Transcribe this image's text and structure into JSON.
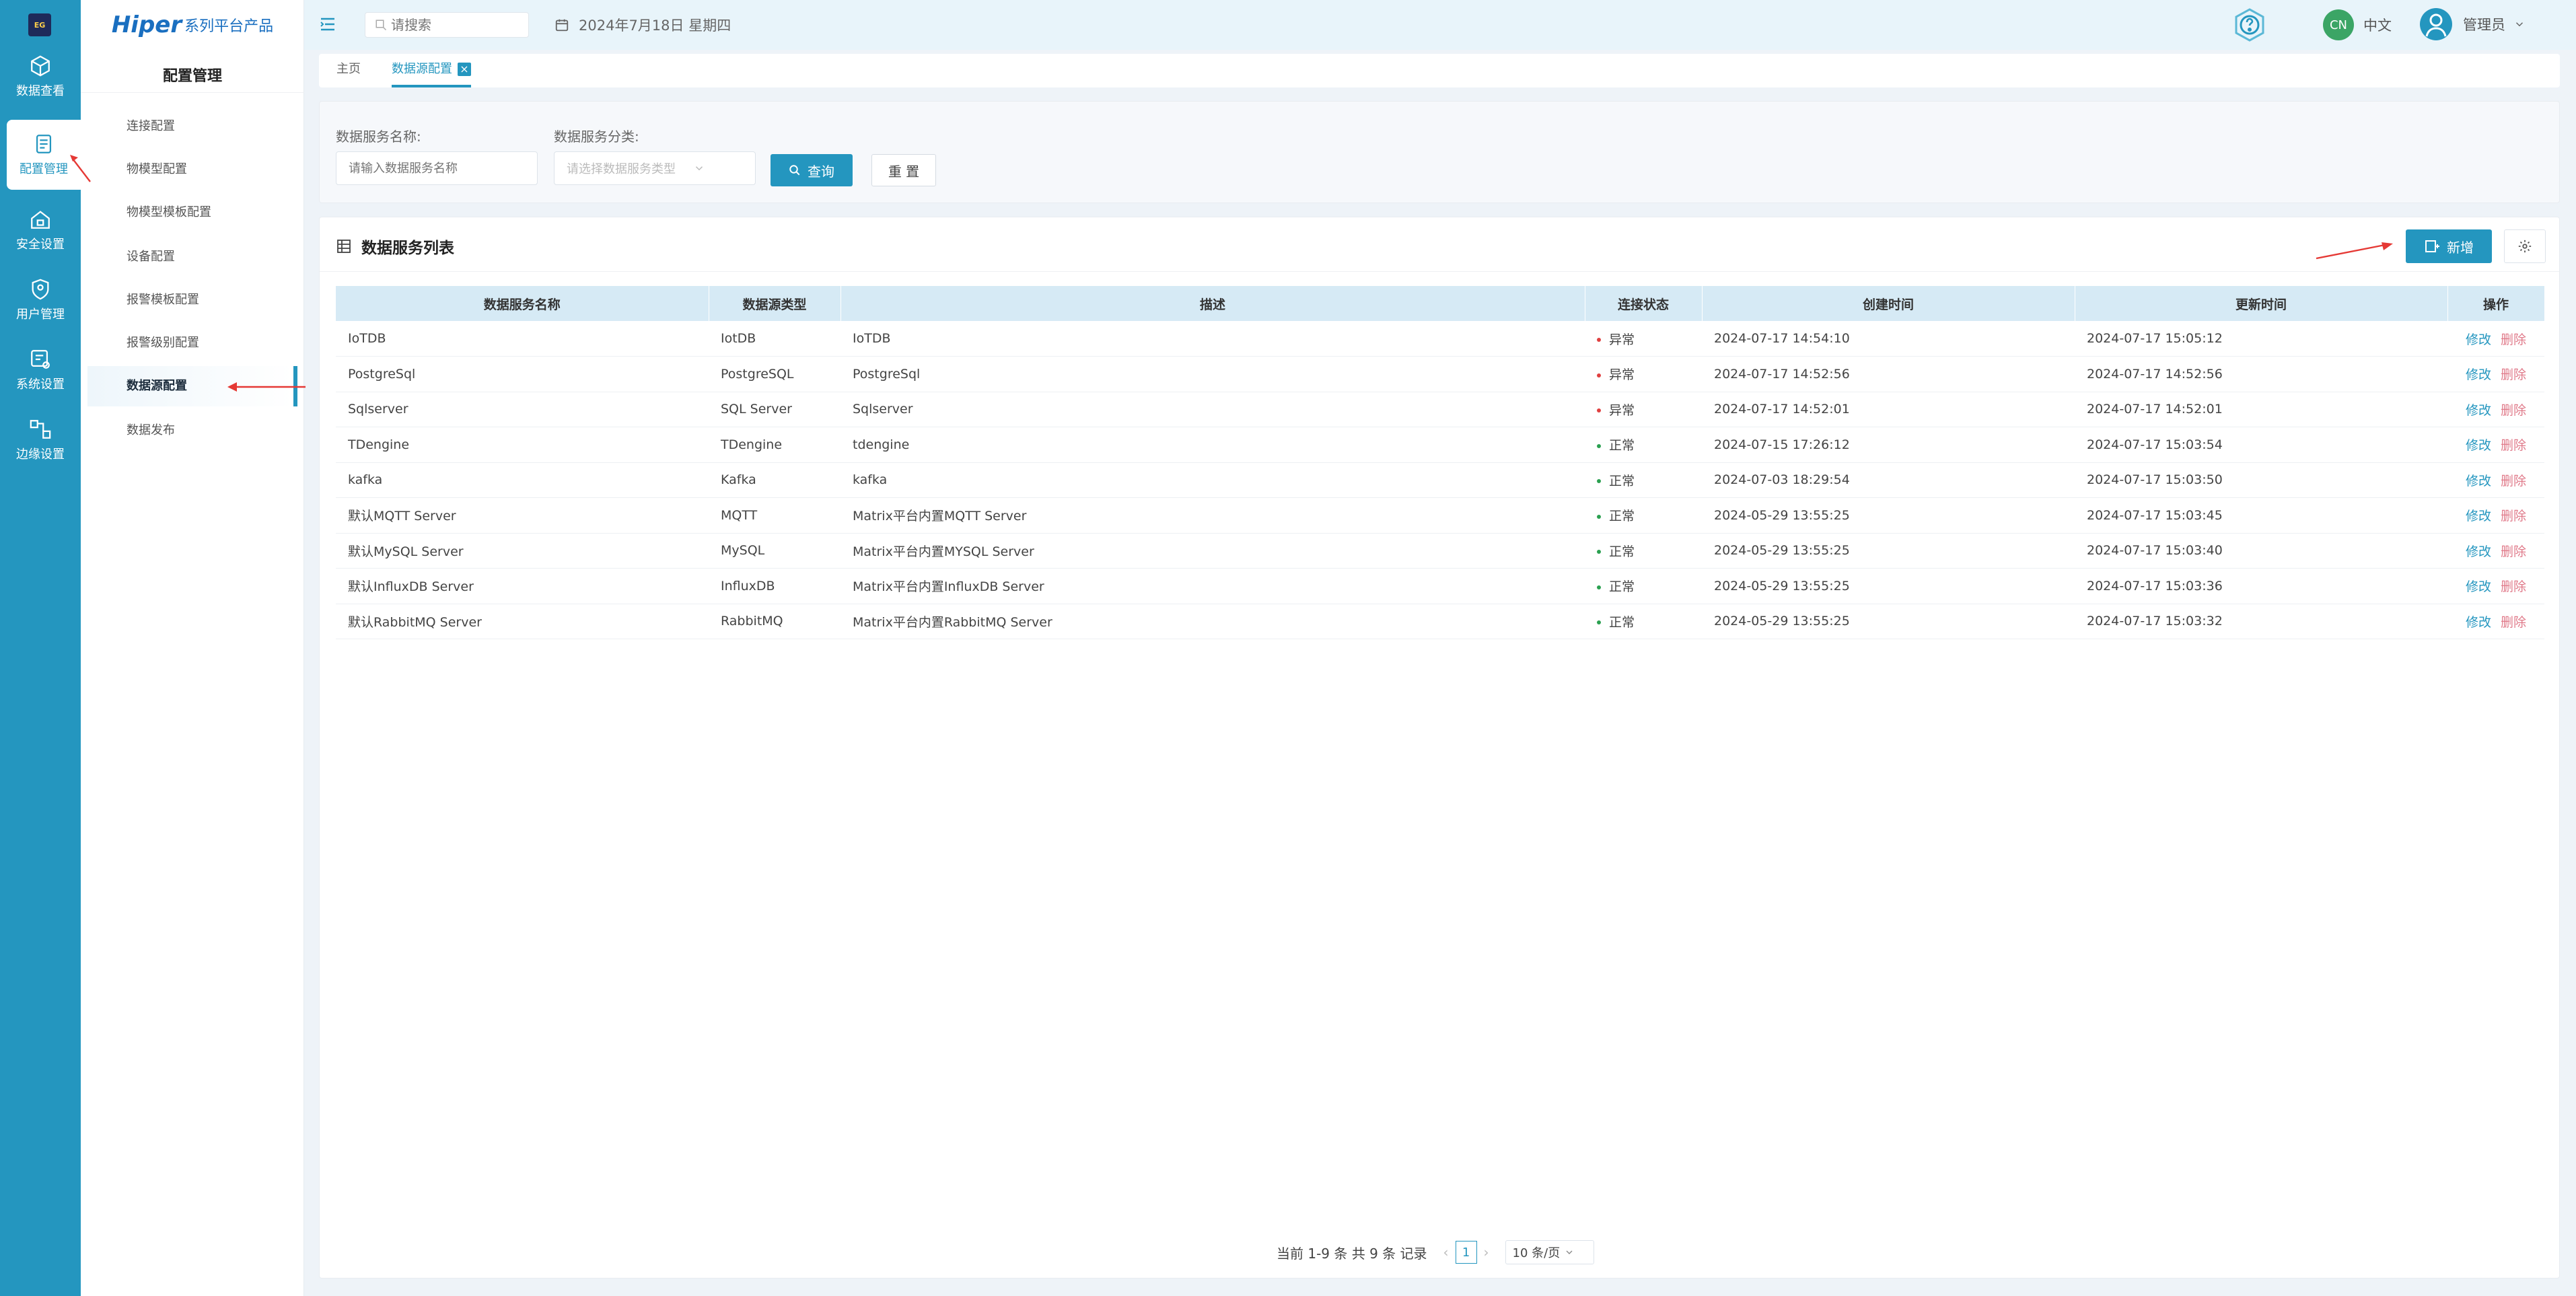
{
  "rail": {
    "items": [
      {
        "label": "数据查看"
      },
      {
        "label": "配置管理"
      },
      {
        "label": "安全设置"
      },
      {
        "label": "用户管理"
      },
      {
        "label": "系统设置"
      },
      {
        "label": "边缘设置"
      }
    ]
  },
  "brand": {
    "main": "Hiper",
    "sub": "系列平台产品"
  },
  "sidebar": {
    "title": "配置管理",
    "items": [
      {
        "label": "连接配置"
      },
      {
        "label": "物模型配置"
      },
      {
        "label": "物模型模板配置"
      },
      {
        "label": "设备配置"
      },
      {
        "label": "报警模板配置"
      },
      {
        "label": "报警级别配置"
      },
      {
        "label": "数据源配置"
      },
      {
        "label": "数据发布"
      }
    ]
  },
  "topbar": {
    "search_placeholder": "请搜索",
    "date": "2024年7月18日 星期四",
    "lang_badge": "CN",
    "lang_label": "中文",
    "user": "管理员"
  },
  "tabs": {
    "home": "主页",
    "current": "数据源配置"
  },
  "filter": {
    "name_label": "数据服务名称:",
    "name_placeholder": "请输入数据服务名称",
    "type_label": "数据服务分类:",
    "type_placeholder": "请选择数据服务类型",
    "query": "查询",
    "reset": "重 置"
  },
  "list": {
    "title": "数据服务列表",
    "add": "新增",
    "columns": [
      "数据服务名称",
      "数据源类型",
      "描述",
      "连接状态",
      "创建时间",
      "更新时间",
      "操作"
    ],
    "rows": [
      {
        "name": "IoTDB",
        "type": "IotDB",
        "desc": "IoTDB",
        "status": "异常",
        "status_kind": "err",
        "created": "2024-07-17 14:54:10",
        "updated": "2024-07-17 15:05:12"
      },
      {
        "name": "PostgreSql",
        "type": "PostgreSQL",
        "desc": "PostgreSql",
        "status": "异常",
        "status_kind": "err",
        "created": "2024-07-17 14:52:56",
        "updated": "2024-07-17 14:52:56"
      },
      {
        "name": "Sqlserver",
        "type": "SQL Server",
        "desc": "Sqlserver",
        "status": "异常",
        "status_kind": "err",
        "created": "2024-07-17 14:52:01",
        "updated": "2024-07-17 14:52:01"
      },
      {
        "name": "TDengine",
        "type": "TDengine",
        "desc": "tdengine",
        "status": "正常",
        "status_kind": "ok",
        "created": "2024-07-15 17:26:12",
        "updated": "2024-07-17 15:03:54"
      },
      {
        "name": "kafka",
        "type": "Kafka",
        "desc": "kafka",
        "status": "正常",
        "status_kind": "ok",
        "created": "2024-07-03 18:29:54",
        "updated": "2024-07-17 15:03:50"
      },
      {
        "name": "默认MQTT Server",
        "type": "MQTT",
        "desc": "Matrix平台内置MQTT Server",
        "status": "正常",
        "status_kind": "ok",
        "created": "2024-05-29 13:55:25",
        "updated": "2024-07-17 15:03:45"
      },
      {
        "name": "默认MySQL Server",
        "type": "MySQL",
        "desc": "Matrix平台内置MYSQL Server",
        "status": "正常",
        "status_kind": "ok",
        "created": "2024-05-29 13:55:25",
        "updated": "2024-07-17 15:03:40"
      },
      {
        "name": "默认InfluxDB Server",
        "type": "InfluxDB",
        "desc": "Matrix平台内置InfluxDB Server",
        "status": "正常",
        "status_kind": "ok",
        "created": "2024-05-29 13:55:25",
        "updated": "2024-07-17 15:03:36"
      },
      {
        "name": "默认RabbitMQ Server",
        "type": "RabbitMQ",
        "desc": "Matrix平台内置RabbitMQ Server",
        "status": "正常",
        "status_kind": "ok",
        "created": "2024-05-29 13:55:25",
        "updated": "2024-07-17 15:03:32"
      }
    ],
    "edit_label": "修改",
    "delete_label": "删除"
  },
  "pager": {
    "summary": "当前 1-9 条 共 9 条 记录",
    "page": "1",
    "page_size": "10 条/页"
  },
  "colors": {
    "accent": "#2496bf",
    "error": "#e04040",
    "ok": "#2aa050",
    "annotation": "#e53935"
  }
}
